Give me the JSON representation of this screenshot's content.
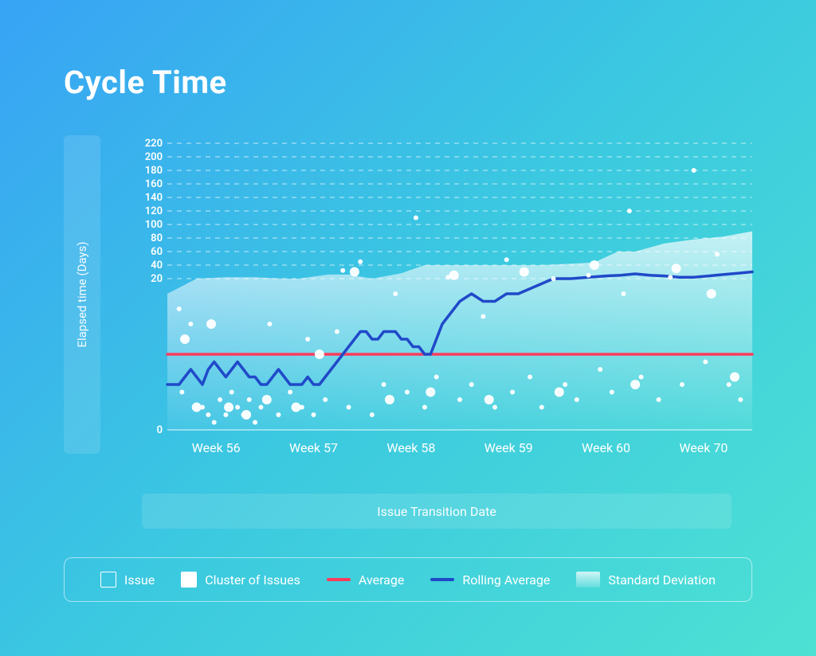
{
  "title": "Cycle Time",
  "ylabel": "Elapsed time (Days)",
  "xlabel": "Issue Transition Date",
  "legend": {
    "issue": "Issue",
    "cluster": "Cluster of Issues",
    "average": "Average",
    "rolling": "Rolling Average",
    "stddev": "Standard Deviation"
  },
  "chart_data": {
    "type": "scatter",
    "title": "Cycle Time",
    "xlabel": "Issue Transition Date",
    "ylabel": "Elapsed time (Days)",
    "ylim": [
      0,
      220
    ],
    "yscale_note": "approximately logarithmic above 20",
    "y_ticks": [
      0,
      20,
      40,
      60,
      80,
      100,
      120,
      140,
      160,
      180,
      200,
      220
    ],
    "x_categories": [
      "Week 56",
      "Week 57",
      "Week 58",
      "Week 59",
      "Week 60",
      "Week 70"
    ],
    "average_line": {
      "value": 10,
      "color": "#ff3b5c"
    },
    "rolling_average": {
      "color": "#2049c9",
      "x": [
        0,
        2,
        4,
        6,
        8,
        10,
        12,
        14,
        16,
        18,
        20,
        22,
        24,
        26,
        28,
        30,
        32,
        34,
        36,
        38,
        40,
        42,
        44,
        46,
        48,
        50,
        52,
        54,
        56,
        58,
        60,
        62,
        64,
        66,
        68,
        70,
        72,
        74,
        76,
        78,
        80,
        82,
        84,
        86,
        88,
        90,
        92,
        94,
        96,
        98,
        100
      ],
      "y": [
        6,
        6,
        6,
        7,
        8,
        7,
        6,
        8,
        9,
        8,
        7,
        8,
        9,
        8,
        7,
        7,
        6,
        6,
        7,
        8,
        7,
        6,
        6,
        6,
        7,
        6,
        6,
        7,
        8,
        9,
        10,
        11,
        12,
        13,
        13,
        12,
        12,
        13,
        13,
        13,
        12,
        12,
        11,
        11,
        10,
        10,
        12,
        14,
        15,
        16,
        17
      ]
    },
    "rolling_average_tail": {
      "x": [
        100,
        104,
        108,
        112,
        116,
        120,
        126,
        132,
        138,
        144,
        150
      ],
      "y": [
        17,
        18,
        17,
        17,
        18,
        18,
        19,
        20,
        20,
        22,
        24
      ]
    },
    "rolling_average_final": {
      "x": [
        150,
        155,
        160,
        165,
        170,
        175,
        180,
        185,
        190,
        195,
        200
      ],
      "y": [
        24,
        25,
        27,
        25,
        24,
        22,
        22,
        24,
        26,
        28,
        30
      ]
    },
    "std_dev_band": {
      "upper_x": [
        0,
        10,
        20,
        30,
        40,
        45,
        55,
        62,
        70,
        80,
        88,
        98,
        108,
        118,
        128,
        138,
        146,
        154,
        160,
        170,
        180,
        190,
        200
      ],
      "upper_y": [
        18,
        20,
        22,
        22,
        20,
        20,
        26,
        26,
        20,
        28,
        40,
        40,
        40,
        40,
        40,
        42,
        44,
        60,
        60,
        72,
        78,
        82,
        90
      ],
      "lower_y_constant": 0
    },
    "issues_small": [
      {
        "x": 4,
        "y": 16
      },
      {
        "x": 8,
        "y": 14
      },
      {
        "x": 5,
        "y": 5
      },
      {
        "x": 12,
        "y": 3
      },
      {
        "x": 14,
        "y": 2
      },
      {
        "x": 16,
        "y": 1
      },
      {
        "x": 18,
        "y": 4
      },
      {
        "x": 20,
        "y": 2
      },
      {
        "x": 22,
        "y": 5
      },
      {
        "x": 24,
        "y": 3
      },
      {
        "x": 26,
        "y": 2
      },
      {
        "x": 28,
        "y": 4
      },
      {
        "x": 30,
        "y": 1
      },
      {
        "x": 32,
        "y": 3
      },
      {
        "x": 35,
        "y": 14
      },
      {
        "x": 38,
        "y": 2
      },
      {
        "x": 42,
        "y": 5
      },
      {
        "x": 46,
        "y": 3
      },
      {
        "x": 48,
        "y": 12
      },
      {
        "x": 50,
        "y": 2
      },
      {
        "x": 54,
        "y": 4
      },
      {
        "x": 58,
        "y": 13
      },
      {
        "x": 60,
        "y": 32
      },
      {
        "x": 62,
        "y": 3
      },
      {
        "x": 66,
        "y": 45
      },
      {
        "x": 70,
        "y": 2
      },
      {
        "x": 74,
        "y": 6
      },
      {
        "x": 78,
        "y": 18
      },
      {
        "x": 82,
        "y": 5
      },
      {
        "x": 85,
        "y": 110
      },
      {
        "x": 88,
        "y": 3
      },
      {
        "x": 92,
        "y": 7
      },
      {
        "x": 96,
        "y": 22
      },
      {
        "x": 100,
        "y": 4
      },
      {
        "x": 104,
        "y": 6
      },
      {
        "x": 108,
        "y": 15
      },
      {
        "x": 112,
        "y": 3
      },
      {
        "x": 116,
        "y": 48
      },
      {
        "x": 118,
        "y": 5
      },
      {
        "x": 124,
        "y": 7
      },
      {
        "x": 128,
        "y": 3
      },
      {
        "x": 132,
        "y": 20
      },
      {
        "x": 136,
        "y": 6
      },
      {
        "x": 140,
        "y": 4
      },
      {
        "x": 144,
        "y": 25
      },
      {
        "x": 148,
        "y": 8
      },
      {
        "x": 152,
        "y": 5
      },
      {
        "x": 156,
        "y": 18
      },
      {
        "x": 158,
        "y": 120
      },
      {
        "x": 162,
        "y": 7
      },
      {
        "x": 168,
        "y": 4
      },
      {
        "x": 172,
        "y": 22
      },
      {
        "x": 176,
        "y": 6
      },
      {
        "x": 180,
        "y": 180
      },
      {
        "x": 184,
        "y": 9
      },
      {
        "x": 188,
        "y": 56
      },
      {
        "x": 192,
        "y": 6
      },
      {
        "x": 196,
        "y": 4
      }
    ],
    "issues_cluster": [
      {
        "x": 6,
        "y": 12
      },
      {
        "x": 10,
        "y": 3
      },
      {
        "x": 15,
        "y": 14
      },
      {
        "x": 21,
        "y": 3
      },
      {
        "x": 27,
        "y": 2
      },
      {
        "x": 34,
        "y": 4
      },
      {
        "x": 44,
        "y": 3
      },
      {
        "x": 52,
        "y": 10
      },
      {
        "x": 64,
        "y": 30
      },
      {
        "x": 76,
        "y": 4
      },
      {
        "x": 90,
        "y": 5
      },
      {
        "x": 98,
        "y": 25
      },
      {
        "x": 110,
        "y": 4
      },
      {
        "x": 122,
        "y": 30
      },
      {
        "x": 134,
        "y": 5
      },
      {
        "x": 146,
        "y": 40
      },
      {
        "x": 160,
        "y": 6
      },
      {
        "x": 174,
        "y": 35
      },
      {
        "x": 186,
        "y": 18
      },
      {
        "x": 194,
        "y": 7
      }
    ]
  }
}
